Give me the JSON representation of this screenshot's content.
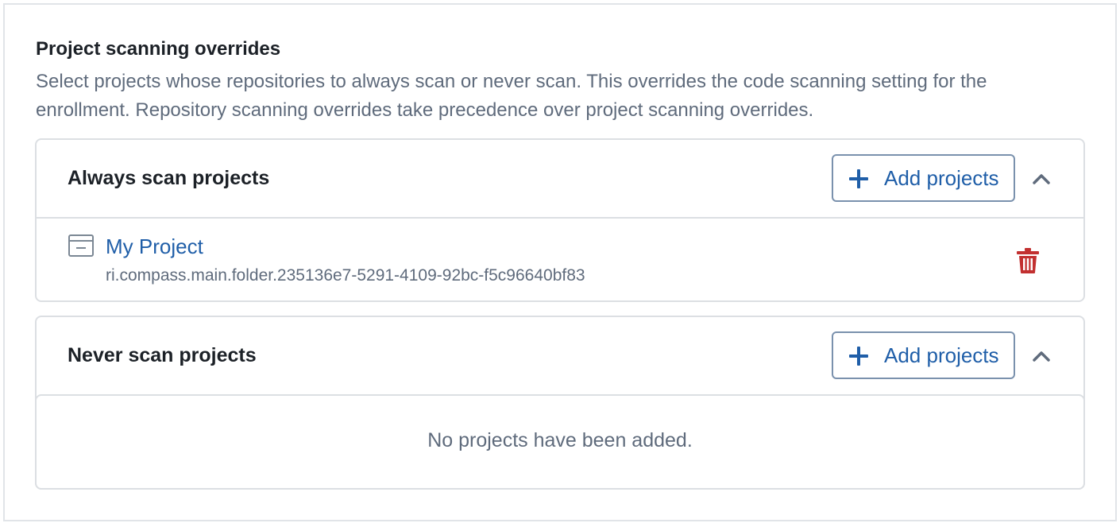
{
  "section": {
    "title": "Project scanning overrides",
    "description_line1": "Select projects whose repositories to always scan or never scan. This overrides the code scanning setting for the",
    "description_line2": "enrollment. Repository scanning overrides take precedence over project scanning overrides."
  },
  "always_scan": {
    "title": "Always scan projects",
    "add_label": "Add projects",
    "expanded": true,
    "projects": [
      {
        "name": "My Project",
        "rid": "ri.compass.main.folder.235136e7-5291-4109-92bc-f5c96640bf83",
        "icon": "folder-icon"
      }
    ]
  },
  "never_scan": {
    "title": "Never scan projects",
    "add_label": "Add projects",
    "expanded": true,
    "empty_message": "No projects have been added."
  },
  "colors": {
    "link_blue": "#1f5ea8",
    "danger_red": "#c23030",
    "muted_text": "#5f6b7c",
    "border": "#dcdfe3"
  },
  "icons": {
    "add": "plus-icon",
    "collapse": "chevron-up-icon",
    "remove": "trash-icon"
  }
}
